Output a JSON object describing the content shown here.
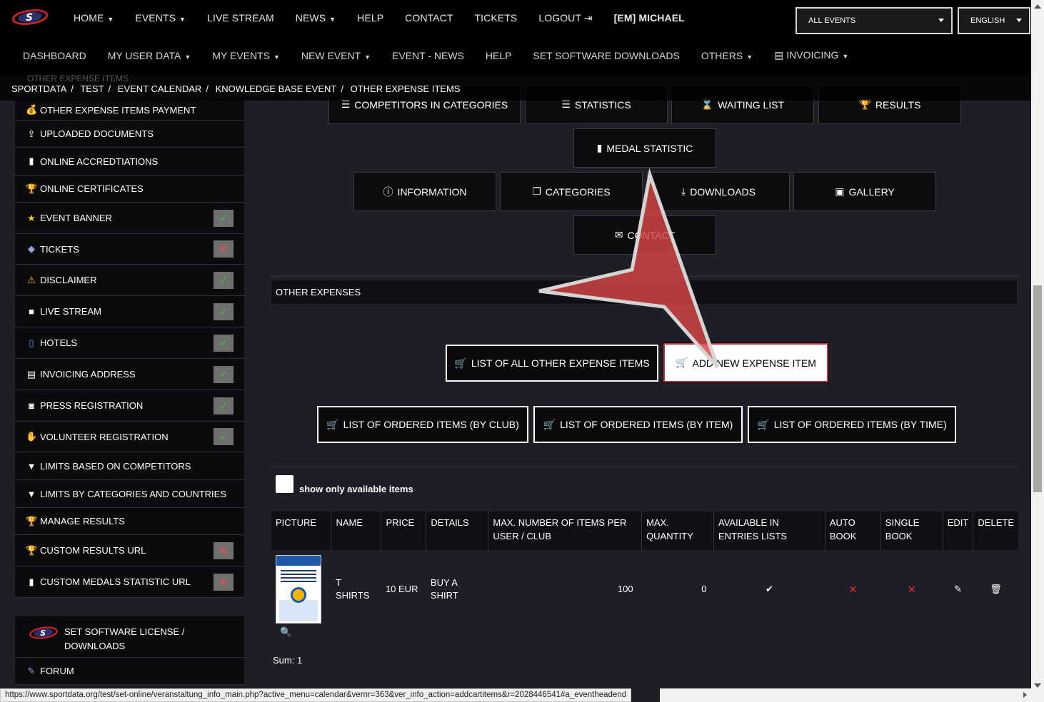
{
  "topnav": {
    "items": [
      "HOME",
      "EVENTS",
      "LIVE STREAM",
      "NEWS",
      "HELP",
      "CONTACT",
      "TICKETS",
      "LOGOUT",
      "[EM] MICHAEL"
    ],
    "events_select": "ALL EVENTS",
    "language_select": "ENGLISH"
  },
  "subnav": {
    "items": [
      "DASHBOARD",
      "MY USER DATA",
      "MY EVENTS",
      "NEW EVENT",
      "EVENT - NEWS",
      "HELP",
      "SET SOFTWARE DOWNLOADS",
      "OTHERS",
      "INVOICING"
    ]
  },
  "breadcrumb": {
    "ghost": "OTHER EXPENSE ITEMS",
    "items": [
      "SPORTDATA",
      "TEST",
      "EVENT CALENDAR",
      "KNOWLEDGE BASE EVENT",
      "OTHER EXPENSE ITEMS"
    ]
  },
  "sidebar": {
    "items": [
      {
        "label": "OTHER EXPENSE ITEMS PAYMENT",
        "icon": "money-icon"
      },
      {
        "label": "UPLOADED DOCUMENTS",
        "icon": "upload-icon"
      },
      {
        "label": "ONLINE ACCREDTIATIONS",
        "icon": "badge-icon"
      },
      {
        "label": "ONLINE CERTIFICATES",
        "icon": "trophy-icon"
      },
      {
        "label": "EVENT BANNER",
        "icon": "star-icon",
        "status": "ok"
      },
      {
        "label": "TICKETS",
        "icon": "ticket-icon",
        "status": "no"
      },
      {
        "label": "DISCLAIMER",
        "icon": "warning-icon",
        "status": "ok"
      },
      {
        "label": "LIVE STREAM",
        "icon": "video-icon",
        "status": "ok"
      },
      {
        "label": "HOTELS",
        "icon": "hotel-icon",
        "status": "ok"
      },
      {
        "label": "INVOICING ADDRESS",
        "icon": "invoice-icon",
        "status": "ok"
      },
      {
        "label": "PRESS REGISTRATION",
        "icon": "camera-icon",
        "status": "ok"
      },
      {
        "label": "VOLUNTEER REGISTRATION",
        "icon": "hand-icon",
        "status": "ok"
      },
      {
        "label": "LIMITS BASED ON COMPETITORS",
        "icon": "filter-icon"
      },
      {
        "label": "LIMITS BY CATEGORIES AND COUNTRIES",
        "icon": "filter-icon"
      },
      {
        "label": "MANAGE RESULTS",
        "icon": "trophy-icon"
      },
      {
        "label": "CUSTOM RESULTS URL",
        "icon": "trophy-icon",
        "status": "no"
      },
      {
        "label": "CUSTOM MEDALS STATISTIC URL",
        "icon": "chart-icon",
        "status": "no"
      }
    ],
    "software_license": "SET SOFTWARE LICENSE / DOWNLOADS",
    "forum": "FORUM"
  },
  "tabs": {
    "competitors": "COMPETITORS IN CATEGORIES",
    "statistics": "STATISTICS",
    "waiting_list": "WAITING LIST",
    "results": "RESULTS",
    "medal_statistic": "MEDAL STATISTIC",
    "information": "INFORMATION",
    "categories": "CATEGORIES",
    "downloads": "DOWNLOADS",
    "gallery": "GALLERY",
    "contact": "CONTACT"
  },
  "section": {
    "title": "OTHER EXPENSES",
    "list_all": "LIST OF ALL OTHER EXPENSE ITEMS",
    "add_new": "ADD NEW EXPENSE ITEM",
    "by_club": "LIST OF ORDERED ITEMS (BY CLUB)",
    "by_item": "LIST OF ORDERED ITEMS (BY ITEM)",
    "by_time": "LIST OF ORDERED ITEMS (BY TIME)",
    "filter_label": "show only available items"
  },
  "table": {
    "headers": [
      "PICTURE",
      "NAME",
      "PRICE",
      "DETAILS",
      "MAX. NUMBER OF ITEMS PER USER / CLUB",
      "MAX. QUANTITY",
      "AVAILABLE IN ENTRIES LISTS",
      "AUTO BOOK",
      "SINGLE BOOK",
      "EDIT",
      "DELETE"
    ],
    "rows": [
      {
        "name": "T SHIRTS",
        "price": "10 EUR",
        "details": "BUY A SHIRT",
        "max_per_user": "100",
        "max_quantity": "0"
      }
    ],
    "sum": "Sum: 1"
  },
  "statusbar": {
    "url": "https://www.sportdata.org/test/set-online/veranstaltung_info_main.php?active_menu=calendar&vernr=363&ver_info_action=addcartitems&r=2028446541#a_eventheadend"
  }
}
